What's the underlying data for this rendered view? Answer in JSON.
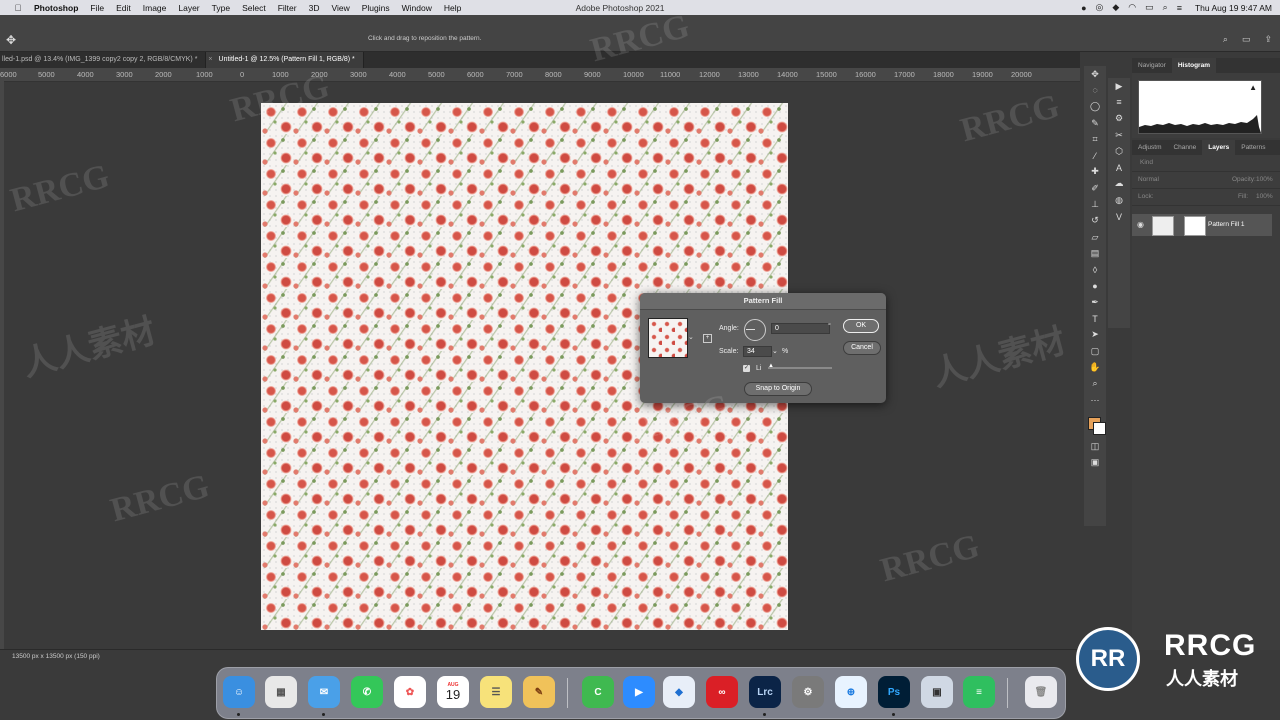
{
  "menubar": {
    "app": "Photoshop",
    "items": [
      "File",
      "Edit",
      "Image",
      "Layer",
      "Type",
      "Select",
      "Filter",
      "3D",
      "View",
      "Plugins",
      "Window",
      "Help"
    ],
    "window_title": "Adobe Photoshop 2021",
    "clock": "Thu Aug 19  9:47 AM"
  },
  "optionsbar": {
    "hint": "Click and drag to reposition the pattern."
  },
  "tabs": [
    {
      "label": "lled-1.psd @ 13.4% (IMG_1399 copy2 copy 2, RGB/8/CMYK) *"
    },
    {
      "label": "Untitled-1 @ 12.5% (Pattern Fill 1, RGB/8) *"
    }
  ],
  "ruler": {
    "ticks": [
      "6000",
      "5000",
      "4000",
      "3000",
      "2000",
      "1000",
      "0",
      "1000",
      "2000",
      "3000",
      "4000",
      "5000",
      "6000",
      "7000",
      "8000",
      "9000",
      "10000",
      "11000",
      "12000",
      "13000",
      "14000",
      "15000",
      "16000",
      "17000",
      "18000",
      "19000",
      "20000"
    ]
  },
  "status": {
    "doc_size": "13500 px x 13500 px (150 ppi)"
  },
  "panels": {
    "top_tabs": [
      "Navigator",
      "Histogram"
    ],
    "active_top": "Histogram",
    "layer_tabs": [
      "Adjustm",
      "Channe",
      "Layers",
      "Patterns"
    ],
    "kind_placeholder": "Kind",
    "blend_mode": "Normal",
    "opacity_label": "Opacity:",
    "opacity_value": "100%",
    "lock_label": "Lock:",
    "fill_label": "Fill:",
    "fill_value": "100%",
    "layer_name": "Pattern Fill 1"
  },
  "dialog": {
    "title": "Pattern Fill",
    "angle_label": "Angle:",
    "angle_value": "0",
    "degree": "°",
    "scale_label": "Scale:",
    "scale_value": "34",
    "percent": "%",
    "link_label": "Li",
    "snap_button": "Snap to Origin",
    "ok": "OK",
    "cancel": "Cancel"
  },
  "dock": {
    "calendar_month": "AUG",
    "calendar_day": "19",
    "lrc": "Lrc",
    "ps": "Ps"
  },
  "watermark": {
    "text": "RRCG",
    "cn": "人人素材"
  },
  "colors": {
    "foreground": "#e7a25a",
    "background": "#ffffff",
    "accent": "#2a5c8c"
  }
}
